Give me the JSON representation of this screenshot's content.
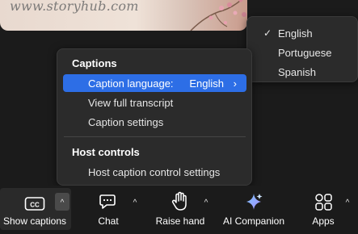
{
  "video": {
    "watermark": "www.storyhub.com"
  },
  "captions_menu": {
    "section_title": "Captions",
    "items": [
      {
        "label": "Caption language:",
        "value": "English",
        "chevron": "›"
      },
      {
        "label": "View full transcript"
      },
      {
        "label": "Caption settings"
      }
    ],
    "host_section_title": "Host controls",
    "host_items": [
      {
        "label": "Host caption control settings"
      }
    ]
  },
  "language_submenu": {
    "selected_mark": "✓",
    "options": [
      "English",
      "Portuguese",
      "Spanish"
    ]
  },
  "toolbar": {
    "caret": "^",
    "buttons": [
      {
        "label": "Show captions",
        "icon": "cc-icon"
      },
      {
        "label": "Chat",
        "icon": "chat-icon"
      },
      {
        "label": "Raise hand",
        "icon": "hand-icon"
      },
      {
        "label": "AI Companion",
        "icon": "sparkle-icon"
      },
      {
        "label": "Apps",
        "icon": "apps-icon"
      }
    ]
  },
  "colors": {
    "accent": "#2d6ee6",
    "menu_bg": "#2b2b2b",
    "background": "#1b1b1b"
  }
}
